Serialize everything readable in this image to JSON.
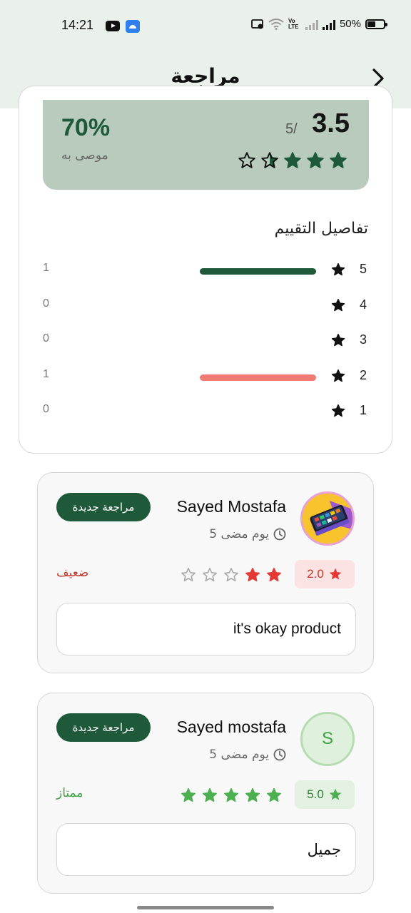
{
  "status_bar": {
    "time": "14:21",
    "battery": "50%",
    "icons": [
      "youtube-icon",
      "android-icon",
      "screen-record-icon",
      "wifi-icon",
      "volte-icon",
      "signal-icon",
      "battery-icon"
    ],
    "volte": "Vo LTE"
  },
  "header": {
    "title": "مراجعة",
    "back_icon": "chevron-right-icon"
  },
  "summary": {
    "average": "3.5",
    "max": "5/",
    "rating_value": 3.5,
    "recommend_percent": "70%",
    "recommend_label": "موصى به",
    "details_title": "تفاصيل التقييم",
    "distribution": [
      {
        "stars": "5",
        "count": "1",
        "fraction": 0.5,
        "color": "#1e5a3a"
      },
      {
        "stars": "4",
        "count": "0",
        "fraction": 0,
        "color": "#1e5a3a"
      },
      {
        "stars": "3",
        "count": "0",
        "fraction": 0,
        "color": "#1e5a3a"
      },
      {
        "stars": "2",
        "count": "1",
        "fraction": 0.5,
        "color": "#ef7b73"
      },
      {
        "stars": "1",
        "count": "0",
        "fraction": 0,
        "color": "#1e5a3a"
      }
    ]
  },
  "reviews": [
    {
      "name": "Sayed Mostafa",
      "time": "5 يوم مضى",
      "badge": "مراجعة جديدة",
      "rating": "2.0",
      "stars": 2,
      "quality": "ضعيف",
      "quality_color": "#c0392b",
      "comment": "it's okay product",
      "avatar": "phone-image",
      "star_color": "#e53935",
      "pill_bg": "#fbe3e3",
      "pill_text_color": "#c0392b"
    },
    {
      "name": "Sayed mostafa",
      "time": "5 يوم مضى",
      "badge": "مراجعة جديدة",
      "rating": "5.0",
      "stars": 5,
      "quality": "ممتاز",
      "quality_color": "#43a047",
      "comment": "جميل",
      "avatar_letter": "S",
      "star_color": "#4caf50",
      "pill_bg": "#e3f1e3",
      "pill_text_color": "#2e7d32"
    }
  ],
  "colors": {
    "primary": "#1e5a3a",
    "header_bg": "#eaf0ea",
    "summary_bg": "#b8cbbc"
  }
}
